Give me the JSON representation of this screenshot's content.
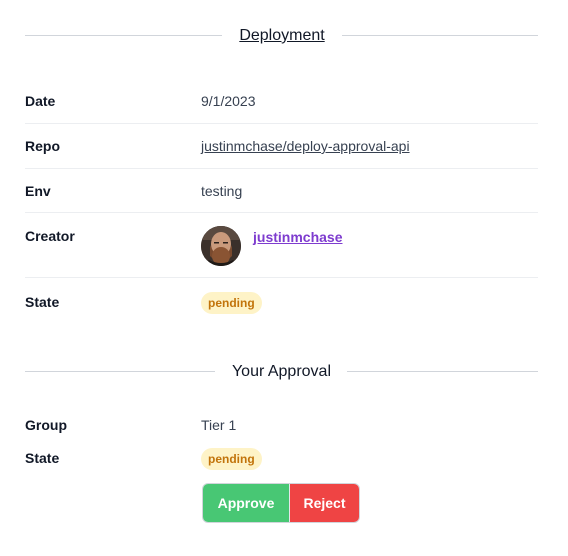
{
  "deployment": {
    "section_title": "Deployment",
    "fields": {
      "date": {
        "label": "Date",
        "value": "9/1/2023"
      },
      "repo": {
        "label": "Repo",
        "value": "justinmchase/deploy-approval-api"
      },
      "env": {
        "label": "Env",
        "value": "testing"
      },
      "creator": {
        "label": "Creator",
        "value": "justinmchase"
      },
      "state": {
        "label": "State",
        "value": "pending"
      }
    }
  },
  "approval": {
    "section_title": "Your Approval",
    "fields": {
      "group": {
        "label": "Group",
        "value": "Tier 1"
      },
      "state": {
        "label": "State",
        "value": "pending"
      }
    },
    "actions": {
      "approve_label": "Approve",
      "reject_label": "Reject"
    }
  },
  "colors": {
    "approve": "#48c774",
    "reject": "#ef4444",
    "pending_bg": "#fef3c7",
    "pending_text": "#c2740b",
    "user_link": "#7e3ccf"
  }
}
